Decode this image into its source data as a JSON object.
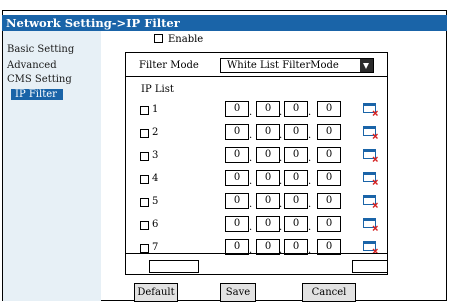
{
  "title": "Network Setting->IP Filter",
  "sidebar": {
    "items": [
      {
        "label": "Basic Setting"
      },
      {
        "label": "Advanced"
      },
      {
        "label": "CMS Setting"
      },
      {
        "label": "IP Filter",
        "active": true
      }
    ]
  },
  "enable": {
    "label": "Enable",
    "checked": false
  },
  "filter_mode": {
    "label": "Filter Mode",
    "value": "White List FilterMode"
  },
  "ip_list": {
    "label": "IP List",
    "rows": [
      {
        "index": "1",
        "checked": false,
        "octets": [
          "0",
          "0",
          "0",
          "0"
        ]
      },
      {
        "index": "2",
        "checked": false,
        "octets": [
          "0",
          "0",
          "0",
          "0"
        ]
      },
      {
        "index": "3",
        "checked": false,
        "octets": [
          "0",
          "0",
          "0",
          "0"
        ]
      },
      {
        "index": "4",
        "checked": false,
        "octets": [
          "0",
          "0",
          "0",
          "0"
        ]
      },
      {
        "index": "5",
        "checked": false,
        "octets": [
          "0",
          "0",
          "0",
          "0"
        ]
      },
      {
        "index": "6",
        "checked": false,
        "octets": [
          "0",
          "0",
          "0",
          "0"
        ]
      },
      {
        "index": "7",
        "checked": false,
        "octets": [
          "0",
          "0",
          "0",
          "0"
        ]
      }
    ]
  },
  "buttons": {
    "default": "Default",
    "save": "Save",
    "cancel": "Cancel"
  },
  "colors": {
    "titlebar": "#1a64a8",
    "sidebar": "#e7f0f6",
    "active_item": "#1a64a8",
    "delete_x": "#d42020"
  },
  "icons": {
    "delete": "delete-row-icon",
    "dropdown": "chevron-down-icon"
  }
}
